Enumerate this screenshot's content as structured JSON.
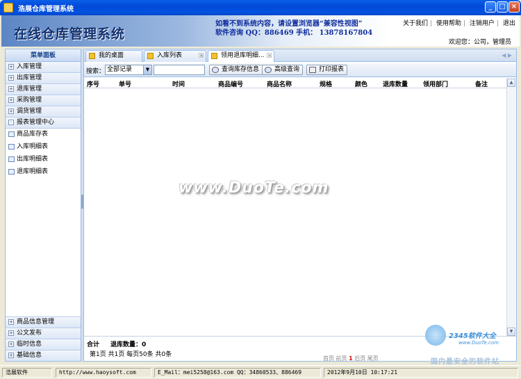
{
  "window": {
    "title": "浩展仓库管理系统",
    "min": "_",
    "max": "□",
    "close": "×"
  },
  "header": {
    "system_title": "在线仓库管理系统",
    "notice_line1": "如看不到系统内容，请设置浏览器“兼容性视图”",
    "notice_line2": "软件咨询 QQ：886469 手机： 13878167804",
    "links": [
      "关于我们",
      "使用帮助",
      "注销用户",
      "退出"
    ],
    "welcome": "欢迎您：公司，管理员"
  },
  "sidebar": {
    "header": "菜单面板",
    "groups_top": [
      "入库管理",
      "出库管理",
      "退库管理",
      "采购管理",
      "调货管理",
      "报表管理中心"
    ],
    "report_items": [
      "商品库存表",
      "入库明细表",
      "出库明细表",
      "退库明细表"
    ],
    "groups_bottom": [
      "商品信息管理",
      "公文发布",
      "临时信息",
      "基础信息"
    ]
  },
  "tabs": [
    {
      "label": "我的桌面"
    },
    {
      "label": "入库列表"
    },
    {
      "label": "领用退库明细..."
    }
  ],
  "toolbar": {
    "search_label": "搜索：",
    "select_value": "全部记录",
    "search_placeholder": "",
    "btn_query": "查询库存信息",
    "btn_advanced": "高级查询",
    "btn_print": "打印报表"
  },
  "table": {
    "columns": [
      "序号",
      "单号",
      "时间",
      "商品编号",
      "商品名称",
      "规格",
      "颜色",
      "退库数量",
      "领用部门",
      "备注"
    ],
    "rows": []
  },
  "summary": {
    "total_label": "合计",
    "qty_label": "退库数量：0",
    "page_info": "第1页 共1页 每页50条 共0条",
    "pager": {
      "first": "首页",
      "prev": "前页",
      "current": "1",
      "next": "后页",
      "last": "尾页"
    }
  },
  "watermark": "www.DuoTe.com",
  "brand": {
    "name": "2345软件大全",
    "url": "www.DuoTe.com",
    "slogan": "国内最安全的软件站"
  },
  "status": {
    "company": "浩展软件",
    "website": "http://www.haoysoft.com",
    "contact": "E_Mail：mei5258@163.com  QQ：34860533、886469",
    "datetime": "2012年9月10日  10:17:21"
  }
}
